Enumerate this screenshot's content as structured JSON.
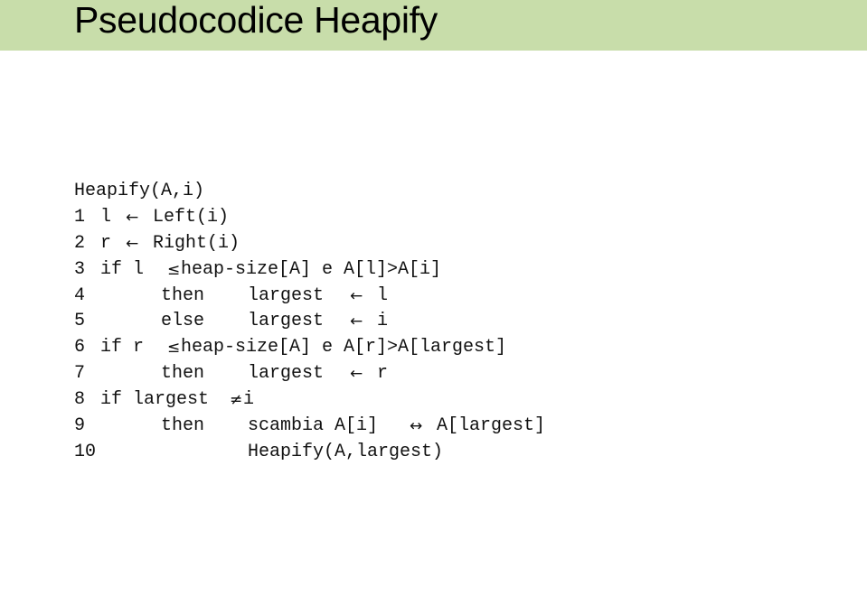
{
  "header": {
    "title": "Pseudocodice Heapify",
    "background_color": "#c8ddaa"
  },
  "code": {
    "signature": "Heapify(A,i)",
    "lines": [
      {
        "num": "1",
        "a": "l",
        "sym": "←",
        "b": "Left(i)"
      },
      {
        "num": "2",
        "a": "r",
        "sym": "←",
        "b": "Right(i)"
      },
      {
        "num": "3",
        "a": "if l",
        "sym": "≤",
        "b": "heap-size[A] e A[l]>A[i]"
      },
      {
        "num": "4",
        "a": "then",
        "c": "largest",
        "sym": "←",
        "b": "l"
      },
      {
        "num": "5",
        "a": "else",
        "c": "largest",
        "sym": "←",
        "b": "i"
      },
      {
        "num": "6",
        "a": "if r",
        "sym": "≤",
        "b": "heap-size[A] e A[r]>A[largest]"
      },
      {
        "num": "7",
        "a": "then",
        "c": "largest",
        "sym": "←",
        "b": "r"
      },
      {
        "num": "8",
        "a": "if largest",
        "sym": "≠",
        "b": "i"
      },
      {
        "num": "9",
        "a": "then",
        "c": "scambia A[i]",
        "sym": "↔",
        "b": "A[largest]"
      },
      {
        "num": "10",
        "c": "Heapify(A,largest)"
      }
    ]
  }
}
